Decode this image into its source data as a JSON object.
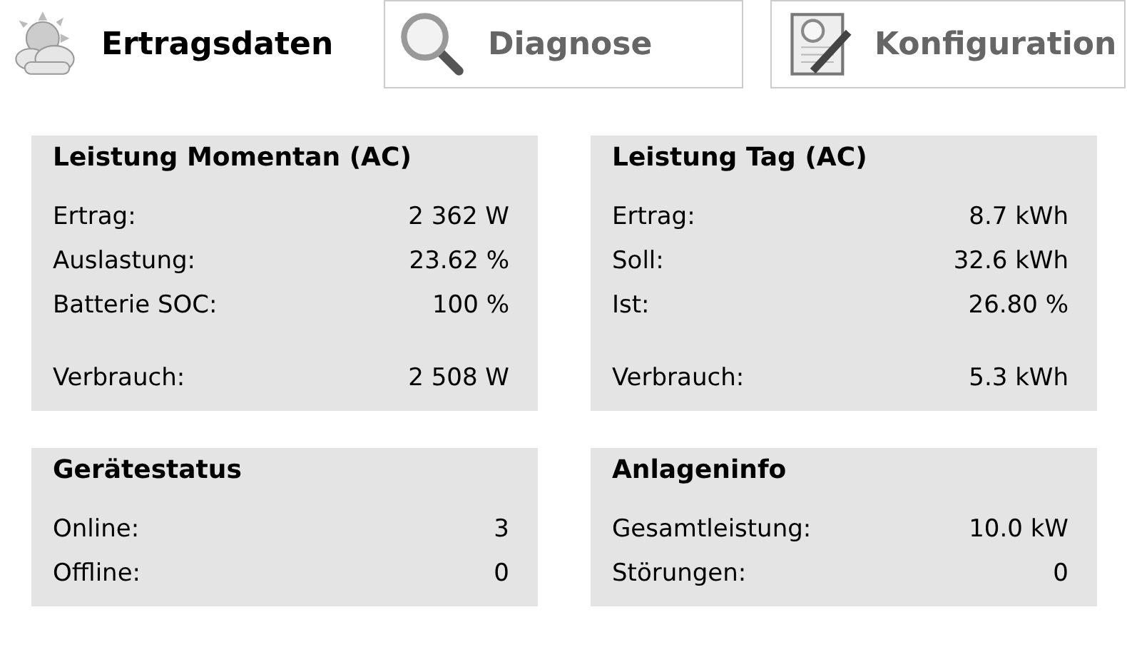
{
  "tabs": [
    {
      "label": "Ertragsdaten",
      "kind": "weather",
      "selected": true
    },
    {
      "label": "Diagnose",
      "kind": "search",
      "selected": false
    },
    {
      "label": "Konfiguration",
      "kind": "edit",
      "selected": false
    }
  ],
  "panels": [
    {
      "title": "Leistung Momentan (AC)",
      "groups": [
        [
          {
            "label": "Ertrag:",
            "value": "2 362 W"
          },
          {
            "label": "Auslastung:",
            "value": "23.62 %"
          },
          {
            "label": "Batterie SOC:",
            "value": "100 %"
          }
        ],
        [
          {
            "label": "Verbrauch:",
            "value": "2 508 W"
          }
        ]
      ]
    },
    {
      "title": "Leistung Tag (AC)",
      "groups": [
        [
          {
            "label": "Ertrag:",
            "value": "8.7 kWh"
          },
          {
            "label": "Soll:",
            "value": "32.6 kWh"
          },
          {
            "label": "Ist:",
            "value": "26.80 %"
          }
        ],
        [
          {
            "label": "Verbrauch:",
            "value": "5.3 kWh"
          }
        ]
      ]
    },
    {
      "title": "Gerätestatus",
      "groups": [
        [
          {
            "label": "Online:",
            "value": "3"
          },
          {
            "label": "Offline:",
            "value": "0"
          }
        ]
      ]
    },
    {
      "title": "Anlageninfo",
      "groups": [
        [
          {
            "label": "Gesamtleistung:",
            "value": "10.0 kW"
          },
          {
            "label": "Störungen:",
            "value": "0"
          }
        ]
      ]
    }
  ]
}
